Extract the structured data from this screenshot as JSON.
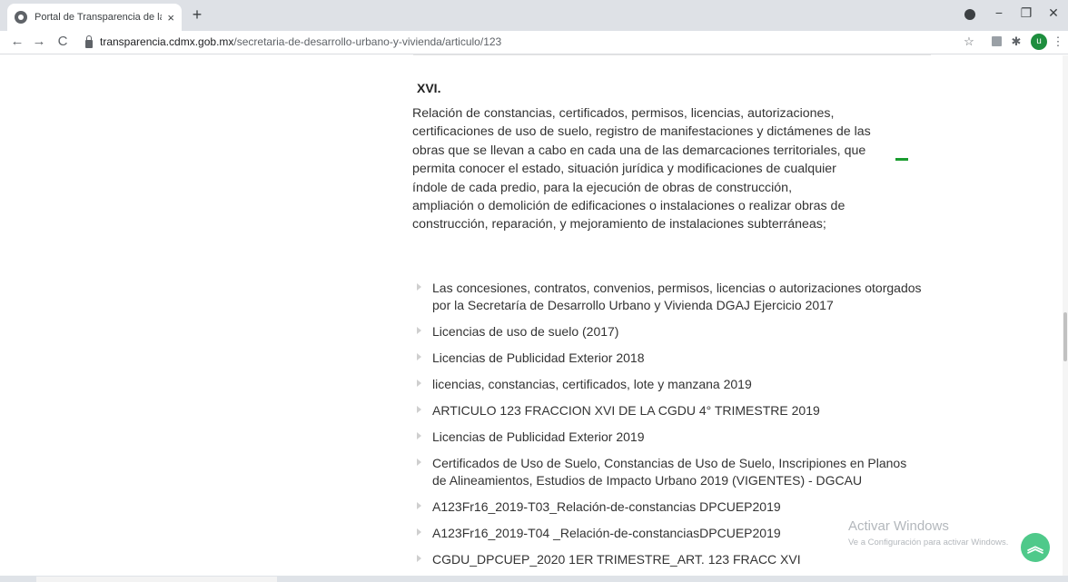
{
  "browser": {
    "tab_title": "Portal de Transparencia de la CDMX",
    "tab_close": "×",
    "new_tab": "+",
    "url_host": "transparencia.cdmx.gob.mx",
    "url_path": "/secretaria-de-desarrollo-urbano-y-vivienda/articulo/123",
    "back": "←",
    "forward": "→",
    "reload": "C",
    "bookmark_star": "☆",
    "extensions_icon": "✱",
    "avatar_letter": "u",
    "menu": "⋮",
    "minimize": "−",
    "restore": "❐",
    "close": "✕"
  },
  "content": {
    "heading": "XVI.",
    "paragraph_lines": [
      "Relación de constancias, certificados, permisos, licencias, autorizaciones,",
      "certificaciones de uso de suelo, registro de manifestaciones y dictámenes de las",
      "obras que se llevan a cabo en cada una de las demarcaciones territoriales, que",
      "permita conocer el estado, situación jurídica y modificaciones de cualquier",
      "índole de cada predio, para la ejecución de obras de construcción,",
      "ampliación o demolición de edificaciones o instalaciones o realizar obras de",
      "construcción, reparación, y mejoramiento de instalaciones subterráneas;"
    ],
    "links": [
      [
        "Las concesiones, contratos, convenios, permisos, licencias o autorizaciones otorgados",
        "por la Secretaría de Desarrollo Urbano y Vivienda DGAJ Ejercicio 2017"
      ],
      [
        "Licencias de uso de suelo (2017)"
      ],
      [
        "Licencias de Publicidad Exterior 2018"
      ],
      [
        "licencias, constancias, certificados, lote y manzana 2019"
      ],
      [
        "ARTICULO 123 FRACCION XVI DE LA CGDU 4° TRIMESTRE 2019"
      ],
      [
        "Licencias de Publicidad Exterior 2019"
      ],
      [
        "Certificados de Uso de Suelo, Constancias de Uso de Suelo, Inscripiones en Planos",
        "de Alineamientos, Estudios de Impacto Urbano 2019 (VIGENTES) - DGCAU"
      ],
      [
        "A123Fr16_2019-T03_Relación-de-constancias DPCUEP2019"
      ],
      [
        "A123Fr16_2019-T04 _Relación-de-constanciasDPCUEP2019"
      ],
      [
        "CGDU_DPCUEP_2020 1ER TRIMESTRE_ART. 123 FRACC XVI"
      ]
    ]
  },
  "overlay": {
    "watermark_title": "Activar Windows",
    "watermark_sub": "Ve a Configuración para activar Windows.",
    "scroll_top": "︽",
    "accent_green": "#1a9c2f",
    "button_green": "#4fc98a"
  }
}
